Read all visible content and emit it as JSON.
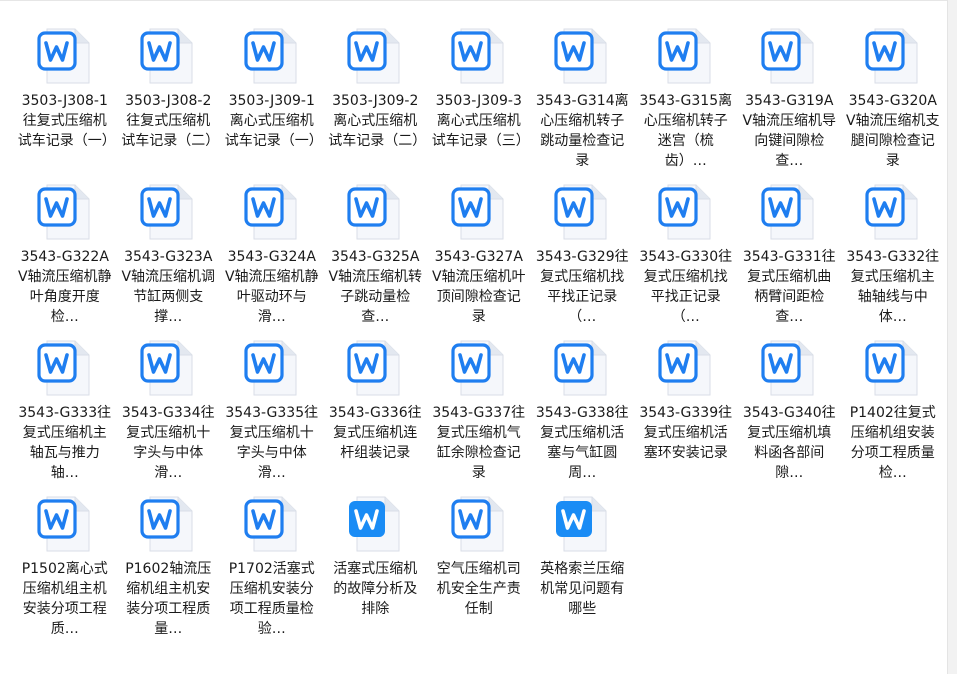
{
  "files": [
    {
      "name": "3503-J308-1往复式压缩机试车记录（一）",
      "type": "word"
    },
    {
      "name": "3503-J308-2往复式压缩机试车记录（二）",
      "type": "word"
    },
    {
      "name": "3503-J309-1离心式压缩机试车记录（一）",
      "type": "word"
    },
    {
      "name": "3503-J309-2离心式压缩机试车记录（二）",
      "type": "word"
    },
    {
      "name": "3503-J309-3离心式压缩机试车记录（三）",
      "type": "word"
    },
    {
      "name": "3543-G314离心压缩机转子跳动量检查记录",
      "type": "word"
    },
    {
      "name": "3543-G315离心压缩机转子迷宫（梳齿）…",
      "type": "word"
    },
    {
      "name": "3543-G319AV轴流压缩机导向键间隙检查…",
      "type": "word"
    },
    {
      "name": "3543-G320AV轴流压缩机支腿间隙检查记录",
      "type": "word"
    },
    {
      "name": "3543-G322AV轴流压缩机静叶角度开度检…",
      "type": "word"
    },
    {
      "name": "3543-G323AV轴流压缩机调节缸两侧支撑…",
      "type": "word"
    },
    {
      "name": "3543-G324AV轴流压缩机静叶驱动环与滑…",
      "type": "word"
    },
    {
      "name": "3543-G325AV轴流压缩机转子跳动量检查…",
      "type": "word"
    },
    {
      "name": "3543-G327AV轴流压缩机叶顶间隙检查记录",
      "type": "word"
    },
    {
      "name": "3543-G329往复式压缩机找平找正记录（…",
      "type": "word"
    },
    {
      "name": "3543-G330往复式压缩机找平找正记录（…",
      "type": "word"
    },
    {
      "name": "3543-G331往复式压缩机曲柄臂间距检查…",
      "type": "word"
    },
    {
      "name": "3543-G332往复式压缩机主轴轴线与中体…",
      "type": "word"
    },
    {
      "name": "3543-G333往复式压缩机主轴瓦与推力轴…",
      "type": "word"
    },
    {
      "name": "3543-G334往复式压缩机十字头与中体滑…",
      "type": "word"
    },
    {
      "name": "3543-G335往复式压缩机十字头与中体滑…",
      "type": "word"
    },
    {
      "name": "3543-G336往复式压缩机连杆组装记录",
      "type": "word"
    },
    {
      "name": "3543-G337往复式压缩机气缸余隙检查记录",
      "type": "word"
    },
    {
      "name": "3543-G338往复式压缩机活塞与气缸圆周…",
      "type": "word"
    },
    {
      "name": "3543-G339往复式压缩机活塞环安装记录",
      "type": "word"
    },
    {
      "name": "3543-G340往复式压缩机填料函各部间隙…",
      "type": "word"
    },
    {
      "name": "P1402往复式压缩机组安装分项工程质量检…",
      "type": "word"
    },
    {
      "name": "P1502离心式压缩机组主机安装分项工程质…",
      "type": "word"
    },
    {
      "name": "P1602轴流压缩机组主机安装分项工程质量…",
      "type": "word"
    },
    {
      "name": "P1702活塞式压缩机安装分项工程质量检验…",
      "type": "word"
    },
    {
      "name": "活塞式压缩机的故障分析及排除",
      "type": "wps"
    },
    {
      "name": "空气压缩机司机安全生产责任制",
      "type": "word"
    },
    {
      "name": "英格索兰压缩机常见问题有哪些",
      "type": "wps"
    }
  ],
  "colors": {
    "word_icon": "#1f7ef0",
    "wps_icon": "#1a8cf5",
    "page_paper": "#eef3fb"
  }
}
